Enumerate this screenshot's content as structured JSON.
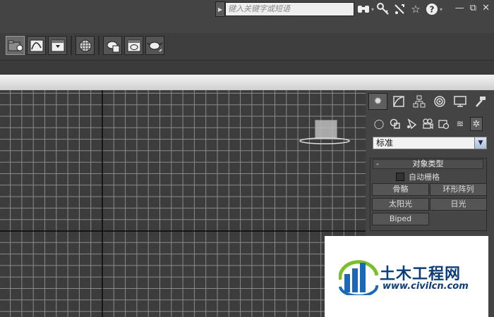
{
  "search": {
    "placeholder": "键入关键字或短语"
  },
  "toolbar": {
    "buttons": [
      "scene-explorer",
      "curve-editor",
      "render-setup",
      "material-editor",
      "render-frame",
      "render",
      "render-iterative"
    ]
  },
  "command_panel": {
    "tabs": [
      "create",
      "modify",
      "hierarchy",
      "motion",
      "display",
      "utilities"
    ],
    "subtabs": [
      "geometry",
      "shapes",
      "lights",
      "cameras",
      "helpers",
      "spacewarps",
      "systems"
    ],
    "category": "标准",
    "rollout": {
      "minus": "-",
      "title": "对象类型",
      "autogrid_label": "自动栅格",
      "buttons": [
        "骨骼",
        "环形阵列",
        "太阳光",
        "日光",
        "Biped"
      ]
    }
  },
  "watermark": {
    "title": "土木工程网",
    "url": "www.civilcn.com"
  },
  "colors": {
    "grid_minor": "#8a8a8a",
    "grid_major": "#0a0a0a",
    "watermark_blue": "#0a3d7a",
    "watermark_green": "#7bbf2a"
  }
}
